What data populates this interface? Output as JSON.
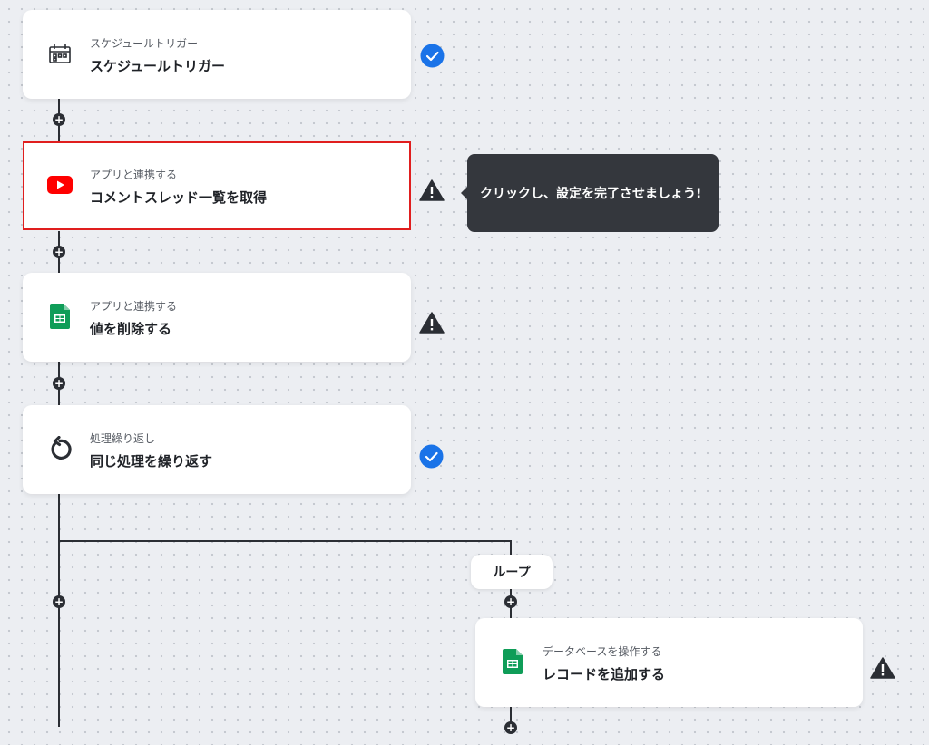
{
  "flow": {
    "steps": [
      {
        "subtitle": "スケジュールトリガー",
        "title": "スケジュールトリガー",
        "icon": "schedule-calendar-icon",
        "status": "check-circle-icon"
      },
      {
        "subtitle": "アプリと連携する",
        "title": "コメントスレッド一覧を取得",
        "icon": "youtube-icon",
        "status": "warning-icon"
      },
      {
        "subtitle": "アプリと連携する",
        "title": "値を削除する",
        "icon": "google-sheets-icon",
        "status": "warning-icon"
      },
      {
        "subtitle": "処理繰り返し",
        "title": "同じ処理を繰り返す",
        "icon": "loop-arrow-icon",
        "status": "check-circle-icon"
      }
    ],
    "loop": {
      "label": "ループ",
      "step": {
        "subtitle": "データベースを操作する",
        "title": "レコードを追加する",
        "icon": "google-sheets-icon",
        "status": "warning-icon"
      }
    },
    "add_step_label": "+"
  },
  "tooltip": {
    "text": "クリックし、設定を完了させましょう!"
  },
  "colors": {
    "background": "#eceef2",
    "line": "#2b2e34",
    "check": "#1a73e8",
    "active_border": "#e01e1e",
    "youtube": "#ff0000",
    "sheets": "#0f9d58",
    "tooltip_bg": "#34373d"
  }
}
